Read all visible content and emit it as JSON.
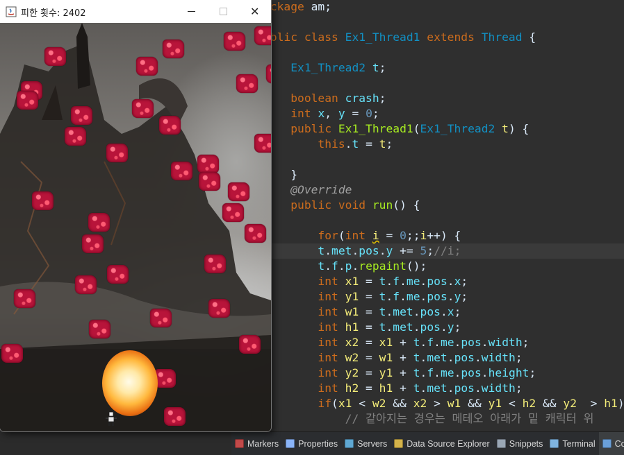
{
  "game_window": {
    "title": "피한 횟수: 2402",
    "icon": "java-app-icon",
    "controls": {
      "minimize": "minimize-icon",
      "maximize": "maximize-icon",
      "close": "✕"
    }
  },
  "editor": {
    "lines": [
      [
        [
          "kw",
          "ackage"
        ],
        [
          "plain",
          " am;"
        ]
      ],
      [],
      [
        [
          "kw",
          "ublic class "
        ],
        [
          "cls",
          "Ex1_Thread1"
        ],
        [
          "kw",
          " extends "
        ],
        [
          "cls",
          "Thread"
        ],
        [
          "plain",
          " {"
        ]
      ],
      [],
      [
        [
          "plain",
          "    "
        ],
        [
          "cls",
          "Ex1_Thread2"
        ],
        [
          "plain",
          " "
        ],
        [
          "fld",
          "t"
        ],
        [
          "plain",
          ";"
        ]
      ],
      [],
      [
        [
          "plain",
          "    "
        ],
        [
          "kw",
          "boolean "
        ],
        [
          "fld",
          "crash"
        ],
        [
          "plain",
          ";"
        ]
      ],
      [
        [
          "plain",
          "    "
        ],
        [
          "kw",
          "int "
        ],
        [
          "fld",
          "x"
        ],
        [
          "plain",
          ", "
        ],
        [
          "fld",
          "y"
        ],
        [
          "plain",
          " = "
        ],
        [
          "num",
          "0"
        ],
        [
          "plain",
          ";"
        ]
      ],
      [
        [
          "plain",
          "    "
        ],
        [
          "kw",
          "public "
        ],
        [
          "fn",
          "Ex1_Thread1"
        ],
        [
          "plain",
          "("
        ],
        [
          "cls",
          "Ex1_Thread2"
        ],
        [
          "plain",
          " "
        ],
        [
          "var",
          "t"
        ],
        [
          "plain",
          ") {"
        ]
      ],
      [
        [
          "plain",
          "        "
        ],
        [
          "kw",
          "this"
        ],
        [
          "plain",
          "."
        ],
        [
          "fld",
          "t"
        ],
        [
          "plain",
          " = "
        ],
        [
          "var",
          "t"
        ],
        [
          "plain",
          ";"
        ]
      ],
      [],
      [
        [
          "plain",
          "    }"
        ]
      ],
      [
        [
          "plain",
          "    "
        ],
        [
          "ann",
          "@Override"
        ]
      ],
      [
        [
          "plain",
          "    "
        ],
        [
          "kw",
          "public void "
        ],
        [
          "fn",
          "run"
        ],
        [
          "plain",
          "() {"
        ]
      ],
      [],
      [
        [
          "plain",
          "        "
        ],
        [
          "kw",
          "for"
        ],
        [
          "plain",
          "("
        ],
        [
          "kw",
          "int "
        ],
        [
          "var warn",
          "i"
        ],
        [
          "plain",
          " = "
        ],
        [
          "num",
          "0"
        ],
        [
          "plain",
          ";;"
        ],
        [
          "var",
          "i"
        ],
        [
          "plain",
          "++) {"
        ]
      ],
      [
        [
          "plain",
          "        "
        ],
        [
          "fld",
          "t"
        ],
        [
          "plain",
          "."
        ],
        [
          "fld",
          "met"
        ],
        [
          "plain",
          "."
        ],
        [
          "fld",
          "pos"
        ],
        [
          "plain",
          "."
        ],
        [
          "fld",
          "y"
        ],
        [
          "plain",
          " += "
        ],
        [
          "num",
          "5"
        ],
        [
          "plain",
          ";"
        ],
        [
          "cmt",
          "//i;"
        ]
      ],
      [
        [
          "plain",
          "        "
        ],
        [
          "fld",
          "t"
        ],
        [
          "plain",
          "."
        ],
        [
          "fld",
          "f"
        ],
        [
          "plain",
          "."
        ],
        [
          "fld",
          "p"
        ],
        [
          "plain",
          "."
        ],
        [
          "fn",
          "repaint"
        ],
        [
          "plain",
          "();"
        ]
      ],
      [
        [
          "plain",
          "        "
        ],
        [
          "kw",
          "int "
        ],
        [
          "var",
          "x1"
        ],
        [
          "plain",
          " = "
        ],
        [
          "fld",
          "t"
        ],
        [
          "plain",
          "."
        ],
        [
          "fld",
          "f"
        ],
        [
          "plain",
          "."
        ],
        [
          "fld",
          "me"
        ],
        [
          "plain",
          "."
        ],
        [
          "fld",
          "pos"
        ],
        [
          "plain",
          "."
        ],
        [
          "fld",
          "x"
        ],
        [
          "plain",
          ";"
        ]
      ],
      [
        [
          "plain",
          "        "
        ],
        [
          "kw",
          "int "
        ],
        [
          "var",
          "y1"
        ],
        [
          "plain",
          " = "
        ],
        [
          "fld",
          "t"
        ],
        [
          "plain",
          "."
        ],
        [
          "fld",
          "f"
        ],
        [
          "plain",
          "."
        ],
        [
          "fld",
          "me"
        ],
        [
          "plain",
          "."
        ],
        [
          "fld",
          "pos"
        ],
        [
          "plain",
          "."
        ],
        [
          "fld",
          "y"
        ],
        [
          "plain",
          ";"
        ]
      ],
      [
        [
          "plain",
          "        "
        ],
        [
          "kw",
          "int "
        ],
        [
          "var",
          "w1"
        ],
        [
          "plain",
          " = "
        ],
        [
          "fld",
          "t"
        ],
        [
          "plain",
          "."
        ],
        [
          "fld",
          "met"
        ],
        [
          "plain",
          "."
        ],
        [
          "fld",
          "pos"
        ],
        [
          "plain",
          "."
        ],
        [
          "fld",
          "x"
        ],
        [
          "plain",
          ";"
        ]
      ],
      [
        [
          "plain",
          "        "
        ],
        [
          "kw",
          "int "
        ],
        [
          "var",
          "h1"
        ],
        [
          "plain",
          " = "
        ],
        [
          "fld",
          "t"
        ],
        [
          "plain",
          "."
        ],
        [
          "fld",
          "met"
        ],
        [
          "plain",
          "."
        ],
        [
          "fld",
          "pos"
        ],
        [
          "plain",
          "."
        ],
        [
          "fld",
          "y"
        ],
        [
          "plain",
          ";"
        ]
      ],
      [
        [
          "plain",
          "        "
        ],
        [
          "kw",
          "int "
        ],
        [
          "var",
          "x2"
        ],
        [
          "plain",
          " = "
        ],
        [
          "var",
          "x1"
        ],
        [
          "plain",
          " + "
        ],
        [
          "fld",
          "t"
        ],
        [
          "plain",
          "."
        ],
        [
          "fld",
          "f"
        ],
        [
          "plain",
          "."
        ],
        [
          "fld",
          "me"
        ],
        [
          "plain",
          "."
        ],
        [
          "fld",
          "pos"
        ],
        [
          "plain",
          "."
        ],
        [
          "fld",
          "width"
        ],
        [
          "plain",
          ";"
        ]
      ],
      [
        [
          "plain",
          "        "
        ],
        [
          "kw",
          "int "
        ],
        [
          "var",
          "w2"
        ],
        [
          "plain",
          " = "
        ],
        [
          "var",
          "w1"
        ],
        [
          "plain",
          " + "
        ],
        [
          "fld",
          "t"
        ],
        [
          "plain",
          "."
        ],
        [
          "fld",
          "met"
        ],
        [
          "plain",
          "."
        ],
        [
          "fld",
          "pos"
        ],
        [
          "plain",
          "."
        ],
        [
          "fld",
          "width"
        ],
        [
          "plain",
          ";"
        ]
      ],
      [
        [
          "plain",
          "        "
        ],
        [
          "kw",
          "int "
        ],
        [
          "var",
          "y2"
        ],
        [
          "plain",
          " = "
        ],
        [
          "var",
          "y1"
        ],
        [
          "plain",
          " + "
        ],
        [
          "fld",
          "t"
        ],
        [
          "plain",
          "."
        ],
        [
          "fld",
          "f"
        ],
        [
          "plain",
          "."
        ],
        [
          "fld",
          "me"
        ],
        [
          "plain",
          "."
        ],
        [
          "fld",
          "pos"
        ],
        [
          "plain",
          "."
        ],
        [
          "fld",
          "height"
        ],
        [
          "plain",
          ";"
        ]
      ],
      [
        [
          "plain",
          "        "
        ],
        [
          "kw",
          "int "
        ],
        [
          "var",
          "h2"
        ],
        [
          "plain",
          " = "
        ],
        [
          "var",
          "h1"
        ],
        [
          "plain",
          " + "
        ],
        [
          "fld",
          "t"
        ],
        [
          "plain",
          "."
        ],
        [
          "fld",
          "met"
        ],
        [
          "plain",
          "."
        ],
        [
          "fld",
          "pos"
        ],
        [
          "plain",
          "."
        ],
        [
          "fld",
          "width"
        ],
        [
          "plain",
          ";"
        ]
      ],
      [
        [
          "plain",
          "        "
        ],
        [
          "kw",
          "if"
        ],
        [
          "plain",
          "("
        ],
        [
          "var",
          "x1"
        ],
        [
          "plain",
          " < "
        ],
        [
          "var",
          "w2"
        ],
        [
          "plain",
          " && "
        ],
        [
          "var",
          "x2"
        ],
        [
          "plain",
          " > "
        ],
        [
          "var",
          "w1"
        ],
        [
          "plain",
          " && "
        ],
        [
          "var",
          "y1"
        ],
        [
          "plain",
          " < "
        ],
        [
          "var",
          "h2"
        ],
        [
          "plain",
          " && "
        ],
        [
          "var",
          "y2"
        ],
        [
          "plain",
          "  > "
        ],
        [
          "var",
          "h1"
        ],
        [
          "plain",
          ") {"
        ]
      ],
      [
        [
          "plain",
          "            "
        ],
        [
          "cmt",
          "// 같아지는 경우는 메테오 아래가 밑 캐릭터 위"
        ]
      ]
    ],
    "current_line_index": 16
  },
  "bottom_tabs": [
    {
      "label": "Markers",
      "icon": "markers-icon",
      "color": "#c24a4a"
    },
    {
      "label": "Properties",
      "icon": "properties-icon",
      "color": "#8ab4f8"
    },
    {
      "label": "Servers",
      "icon": "servers-icon",
      "color": "#5fa8d3"
    },
    {
      "label": "Data Source Explorer",
      "icon": "data-source-explorer-icon",
      "color": "#d4b34a"
    },
    {
      "label": "Snippets",
      "icon": "snippets-icon",
      "color": "#9aa7b5"
    },
    {
      "label": "Terminal",
      "icon": "terminal-icon",
      "color": "#7fb4e0"
    },
    {
      "label": "Con",
      "icon": "console-icon",
      "color": "#6a9fd8",
      "active": true
    }
  ]
}
